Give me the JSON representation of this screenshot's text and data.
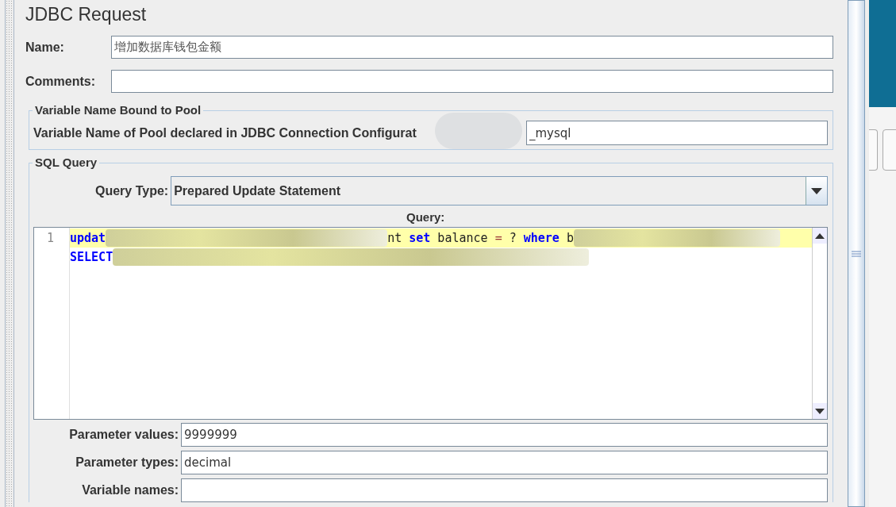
{
  "title": "JDBC Request",
  "name_field": {
    "label": "Name:",
    "value": "增加数据库钱包金额"
  },
  "comments_field": {
    "label": "Comments:"
  },
  "pool_group": {
    "title": "Variable Name Bound to Pool",
    "label": "Variable Name of Pool declared in JDBC Connection Configurat",
    "value": "_mysql"
  },
  "sql_group": {
    "title": "SQL Query",
    "query_type_label": "Query Type:",
    "query_type": "Prepared Update Statement",
    "query_label": "Query:",
    "lines": [
      {
        "number": "1",
        "highlighted": true,
        "segments": [
          {
            "kind": "keyword",
            "text": "updat"
          },
          {
            "kind": "redacted"
          },
          {
            "kind": "plain",
            "text": "nt "
          },
          {
            "kind": "keyword",
            "text": "set"
          },
          {
            "kind": "plain",
            "text": " balance "
          },
          {
            "kind": "operator",
            "text": "="
          },
          {
            "kind": "plain",
            "text": " ? "
          },
          {
            "kind": "keyword",
            "text": "where"
          },
          {
            "kind": "plain",
            "text": " b"
          },
          {
            "kind": "redacted"
          }
        ]
      },
      {
        "highlighted": false,
        "segments": [
          {
            "kind": "keyword",
            "text": "SELECT"
          },
          {
            "kind": "redacted"
          }
        ]
      }
    ]
  },
  "params": [
    {
      "label": "Parameter values:",
      "value": "9999999"
    },
    {
      "label": "Parameter types:",
      "value": "decimal"
    },
    {
      "label": "Variable names:"
    }
  ]
}
